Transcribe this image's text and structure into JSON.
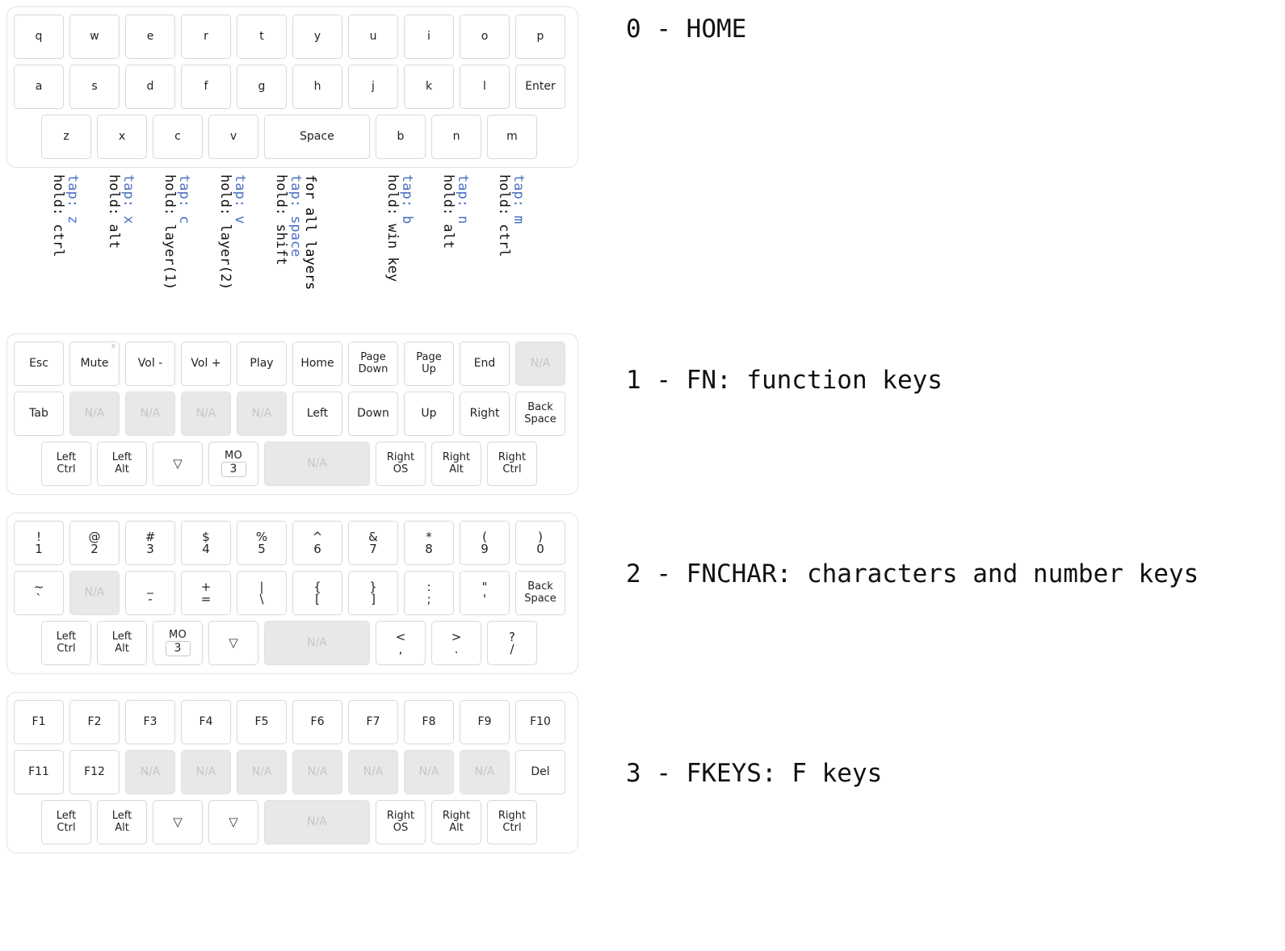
{
  "layers": [
    {
      "id": "home",
      "title": "0 - HOME",
      "rows": [
        {
          "offset": 0,
          "keys": [
            {
              "label": "q"
            },
            {
              "label": "w"
            },
            {
              "label": "e"
            },
            {
              "label": "r"
            },
            {
              "label": "t"
            },
            {
              "label": "y"
            },
            {
              "label": "u"
            },
            {
              "label": "i"
            },
            {
              "label": "o"
            },
            {
              "label": "p"
            }
          ]
        },
        {
          "offset": 0,
          "keys": [
            {
              "label": "a"
            },
            {
              "label": "s"
            },
            {
              "label": "d"
            },
            {
              "label": "f"
            },
            {
              "label": "g"
            },
            {
              "label": "h"
            },
            {
              "label": "j"
            },
            {
              "label": "k"
            },
            {
              "label": "l"
            },
            {
              "label": "Enter"
            }
          ]
        },
        {
          "offset": 0.5,
          "keys": [
            {
              "label": "z"
            },
            {
              "label": "x"
            },
            {
              "label": "c"
            },
            {
              "label": "v"
            },
            {
              "label": "Space",
              "width": 2
            },
            {
              "label": "b"
            },
            {
              "label": "n"
            },
            {
              "label": "m"
            }
          ]
        }
      ],
      "annotations": [
        {
          "tap": "tap: z",
          "hold": "hold: ctrl"
        },
        {
          "tap": "tap: x",
          "hold": "hold: alt"
        },
        {
          "tap": "tap: c",
          "hold": "hold: layer(1)"
        },
        {
          "tap": "tap: v",
          "hold": "hold: layer(2)"
        },
        {
          "tap": "tap: space",
          "hold": "hold: shift",
          "note": "for all layers"
        },
        {
          "tap": "tap: b",
          "hold": "hold: win key"
        },
        {
          "tap": "tap: n",
          "hold": "hold: alt"
        },
        {
          "tap": "tap: m",
          "hold": "hold: ctrl"
        }
      ]
    },
    {
      "id": "fn",
      "title": "1 - FN: function keys",
      "rows": [
        {
          "offset": 0,
          "keys": [
            {
              "label": "Esc"
            },
            {
              "label": "Mute",
              "corner": "x"
            },
            {
              "label": "Vol -"
            },
            {
              "label": "Vol +"
            },
            {
              "label": "Play"
            },
            {
              "label": "Home"
            },
            {
              "line1": "Page",
              "line2": "Down"
            },
            {
              "line1": "Page",
              "line2": "Up"
            },
            {
              "label": "End"
            },
            {
              "label": "N/A",
              "na": true
            }
          ]
        },
        {
          "offset": 0,
          "keys": [
            {
              "label": "Tab"
            },
            {
              "label": "N/A",
              "na": true
            },
            {
              "label": "N/A",
              "na": true
            },
            {
              "label": "N/A",
              "na": true
            },
            {
              "label": "N/A",
              "na": true
            },
            {
              "label": "Left"
            },
            {
              "label": "Down"
            },
            {
              "label": "Up"
            },
            {
              "label": "Right"
            },
            {
              "line1": "Back",
              "line2": "Space"
            }
          ]
        },
        {
          "offset": 0.5,
          "keys": [
            {
              "line1": "Left",
              "line2": "Ctrl"
            },
            {
              "line1": "Left",
              "line2": "Alt"
            },
            {
              "kind": "triangle"
            },
            {
              "kind": "mo",
              "mo_label": "MO",
              "mo_value": "3"
            },
            {
              "label": "N/A",
              "na": true,
              "width": 2
            },
            {
              "line1": "Right",
              "line2": "OS"
            },
            {
              "line1": "Right",
              "line2": "Alt"
            },
            {
              "line1": "Right",
              "line2": "Ctrl"
            }
          ]
        }
      ],
      "annotations": []
    },
    {
      "id": "fnchar",
      "title": "2 - FNCHAR: characters and number keys",
      "rows": [
        {
          "offset": 0,
          "keys": [
            {
              "top": "!",
              "bottom": "1"
            },
            {
              "top": "@",
              "bottom": "2"
            },
            {
              "top": "#",
              "bottom": "3"
            },
            {
              "top": "$",
              "bottom": "4"
            },
            {
              "top": "%",
              "bottom": "5"
            },
            {
              "top": "^",
              "bottom": "6"
            },
            {
              "top": "&",
              "bottom": "7"
            },
            {
              "top": "*",
              "bottom": "8"
            },
            {
              "top": "(",
              "bottom": "9"
            },
            {
              "top": ")",
              "bottom": "0"
            }
          ]
        },
        {
          "offset": 0,
          "keys": [
            {
              "top": "~",
              "bottom": "`"
            },
            {
              "label": "N/A",
              "na": true
            },
            {
              "top": "_",
              "bottom": "-"
            },
            {
              "top": "+",
              "bottom": "="
            },
            {
              "top": "|",
              "bottom": "\\"
            },
            {
              "top": "{",
              "bottom": "["
            },
            {
              "top": "}",
              "bottom": "]"
            },
            {
              "top": ":",
              "bottom": ";"
            },
            {
              "top": "\"",
              "bottom": "'"
            },
            {
              "line1": "Back",
              "line2": "Space"
            }
          ]
        },
        {
          "offset": 0.5,
          "keys": [
            {
              "line1": "Left",
              "line2": "Ctrl"
            },
            {
              "line1": "Left",
              "line2": "Alt"
            },
            {
              "kind": "mo",
              "mo_label": "MO",
              "mo_value": "3"
            },
            {
              "kind": "triangle"
            },
            {
              "label": "N/A",
              "na": true,
              "width": 2
            },
            {
              "top": "<",
              "bottom": ","
            },
            {
              "top": ">",
              "bottom": "."
            },
            {
              "top": "?",
              "bottom": "/"
            }
          ]
        }
      ],
      "annotations": []
    },
    {
      "id": "fkeys",
      "title": "3 - FKEYS: F keys",
      "rows": [
        {
          "offset": 0,
          "keys": [
            {
              "label": "F1"
            },
            {
              "label": "F2"
            },
            {
              "label": "F3"
            },
            {
              "label": "F4"
            },
            {
              "label": "F5"
            },
            {
              "label": "F6"
            },
            {
              "label": "F7"
            },
            {
              "label": "F8"
            },
            {
              "label": "F9"
            },
            {
              "label": "F10"
            }
          ]
        },
        {
          "offset": 0,
          "keys": [
            {
              "label": "F11"
            },
            {
              "label": "F12"
            },
            {
              "label": "N/A",
              "na": true
            },
            {
              "label": "N/A",
              "na": true
            },
            {
              "label": "N/A",
              "na": true
            },
            {
              "label": "N/A",
              "na": true
            },
            {
              "label": "N/A",
              "na": true
            },
            {
              "label": "N/A",
              "na": true
            },
            {
              "label": "N/A",
              "na": true
            },
            {
              "label": "Del"
            }
          ]
        },
        {
          "offset": 0.5,
          "keys": [
            {
              "line1": "Left",
              "line2": "Ctrl"
            },
            {
              "line1": "Left",
              "line2": "Alt"
            },
            {
              "kind": "triangle"
            },
            {
              "kind": "triangle"
            },
            {
              "label": "N/A",
              "na": true,
              "width": 2
            },
            {
              "line1": "Right",
              "line2": "OS"
            },
            {
              "line1": "Right",
              "line2": "Alt"
            },
            {
              "line1": "Right",
              "line2": "Ctrl"
            }
          ]
        }
      ],
      "annotations": []
    }
  ],
  "colors": {
    "tap_text": "#4a6fc4",
    "hold_text": "#111111",
    "all_layers_text": "#c0392b",
    "na_fill": "#e8e8e8",
    "na_text": "#c6c6c6",
    "key_border": "#d8d8d8",
    "panel_border": "#e3e3e3"
  }
}
